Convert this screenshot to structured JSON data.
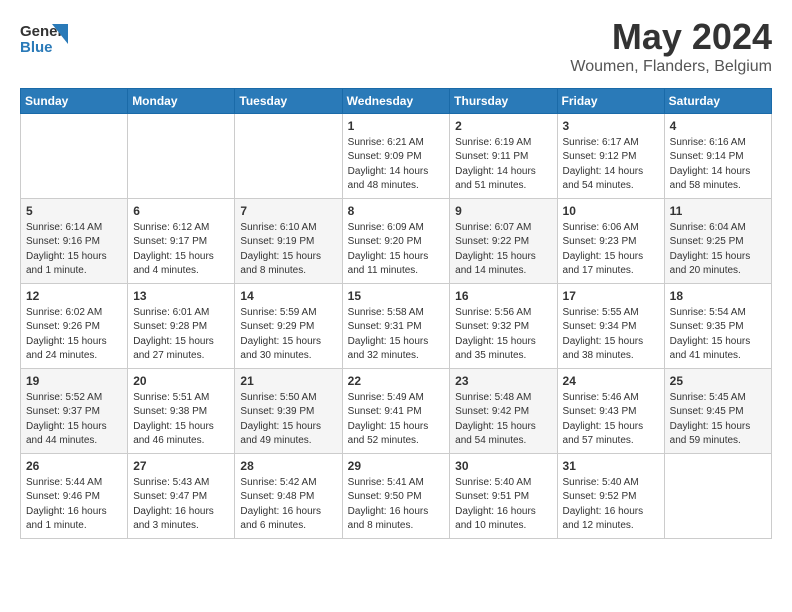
{
  "header": {
    "logo_line1": "General",
    "logo_line2": "Blue",
    "main_title": "May 2024",
    "subtitle": "Woumen, Flanders, Belgium"
  },
  "days_of_week": [
    "Sunday",
    "Monday",
    "Tuesday",
    "Wednesday",
    "Thursday",
    "Friday",
    "Saturday"
  ],
  "weeks": [
    [
      {
        "day": "",
        "info": ""
      },
      {
        "day": "",
        "info": ""
      },
      {
        "day": "",
        "info": ""
      },
      {
        "day": "1",
        "info": "Sunrise: 6:21 AM\nSunset: 9:09 PM\nDaylight: 14 hours\nand 48 minutes."
      },
      {
        "day": "2",
        "info": "Sunrise: 6:19 AM\nSunset: 9:11 PM\nDaylight: 14 hours\nand 51 minutes."
      },
      {
        "day": "3",
        "info": "Sunrise: 6:17 AM\nSunset: 9:12 PM\nDaylight: 14 hours\nand 54 minutes."
      },
      {
        "day": "4",
        "info": "Sunrise: 6:16 AM\nSunset: 9:14 PM\nDaylight: 14 hours\nand 58 minutes."
      }
    ],
    [
      {
        "day": "5",
        "info": "Sunrise: 6:14 AM\nSunset: 9:16 PM\nDaylight: 15 hours\nand 1 minute."
      },
      {
        "day": "6",
        "info": "Sunrise: 6:12 AM\nSunset: 9:17 PM\nDaylight: 15 hours\nand 4 minutes."
      },
      {
        "day": "7",
        "info": "Sunrise: 6:10 AM\nSunset: 9:19 PM\nDaylight: 15 hours\nand 8 minutes."
      },
      {
        "day": "8",
        "info": "Sunrise: 6:09 AM\nSunset: 9:20 PM\nDaylight: 15 hours\nand 11 minutes."
      },
      {
        "day": "9",
        "info": "Sunrise: 6:07 AM\nSunset: 9:22 PM\nDaylight: 15 hours\nand 14 minutes."
      },
      {
        "day": "10",
        "info": "Sunrise: 6:06 AM\nSunset: 9:23 PM\nDaylight: 15 hours\nand 17 minutes."
      },
      {
        "day": "11",
        "info": "Sunrise: 6:04 AM\nSunset: 9:25 PM\nDaylight: 15 hours\nand 20 minutes."
      }
    ],
    [
      {
        "day": "12",
        "info": "Sunrise: 6:02 AM\nSunset: 9:26 PM\nDaylight: 15 hours\nand 24 minutes."
      },
      {
        "day": "13",
        "info": "Sunrise: 6:01 AM\nSunset: 9:28 PM\nDaylight: 15 hours\nand 27 minutes."
      },
      {
        "day": "14",
        "info": "Sunrise: 5:59 AM\nSunset: 9:29 PM\nDaylight: 15 hours\nand 30 minutes."
      },
      {
        "day": "15",
        "info": "Sunrise: 5:58 AM\nSunset: 9:31 PM\nDaylight: 15 hours\nand 32 minutes."
      },
      {
        "day": "16",
        "info": "Sunrise: 5:56 AM\nSunset: 9:32 PM\nDaylight: 15 hours\nand 35 minutes."
      },
      {
        "day": "17",
        "info": "Sunrise: 5:55 AM\nSunset: 9:34 PM\nDaylight: 15 hours\nand 38 minutes."
      },
      {
        "day": "18",
        "info": "Sunrise: 5:54 AM\nSunset: 9:35 PM\nDaylight: 15 hours\nand 41 minutes."
      }
    ],
    [
      {
        "day": "19",
        "info": "Sunrise: 5:52 AM\nSunset: 9:37 PM\nDaylight: 15 hours\nand 44 minutes."
      },
      {
        "day": "20",
        "info": "Sunrise: 5:51 AM\nSunset: 9:38 PM\nDaylight: 15 hours\nand 46 minutes."
      },
      {
        "day": "21",
        "info": "Sunrise: 5:50 AM\nSunset: 9:39 PM\nDaylight: 15 hours\nand 49 minutes."
      },
      {
        "day": "22",
        "info": "Sunrise: 5:49 AM\nSunset: 9:41 PM\nDaylight: 15 hours\nand 52 minutes."
      },
      {
        "day": "23",
        "info": "Sunrise: 5:48 AM\nSunset: 9:42 PM\nDaylight: 15 hours\nand 54 minutes."
      },
      {
        "day": "24",
        "info": "Sunrise: 5:46 AM\nSunset: 9:43 PM\nDaylight: 15 hours\nand 57 minutes."
      },
      {
        "day": "25",
        "info": "Sunrise: 5:45 AM\nSunset: 9:45 PM\nDaylight: 15 hours\nand 59 minutes."
      }
    ],
    [
      {
        "day": "26",
        "info": "Sunrise: 5:44 AM\nSunset: 9:46 PM\nDaylight: 16 hours\nand 1 minute."
      },
      {
        "day": "27",
        "info": "Sunrise: 5:43 AM\nSunset: 9:47 PM\nDaylight: 16 hours\nand 3 minutes."
      },
      {
        "day": "28",
        "info": "Sunrise: 5:42 AM\nSunset: 9:48 PM\nDaylight: 16 hours\nand 6 minutes."
      },
      {
        "day": "29",
        "info": "Sunrise: 5:41 AM\nSunset: 9:50 PM\nDaylight: 16 hours\nand 8 minutes."
      },
      {
        "day": "30",
        "info": "Sunrise: 5:40 AM\nSunset: 9:51 PM\nDaylight: 16 hours\nand 10 minutes."
      },
      {
        "day": "31",
        "info": "Sunrise: 5:40 AM\nSunset: 9:52 PM\nDaylight: 16 hours\nand 12 minutes."
      },
      {
        "day": "",
        "info": ""
      }
    ]
  ]
}
